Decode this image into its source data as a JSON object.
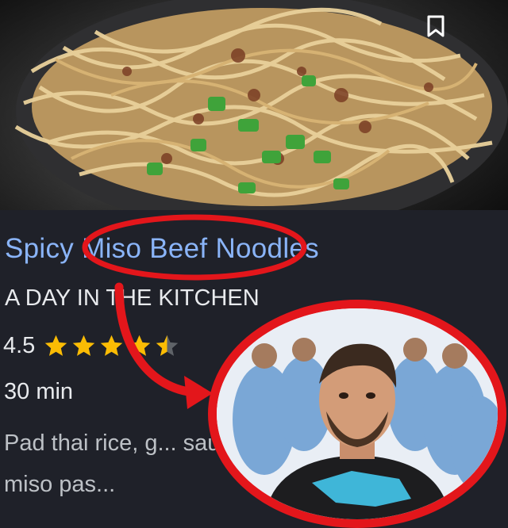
{
  "recipe": {
    "title": "Spicy Miso Beef Noodles",
    "title_visible": "Spicy Miso Beef Noodles",
    "source": "A DAY IN THE KITCHEN",
    "rating": "4.5",
    "stars": 4.5,
    "time": "30 min",
    "ingredients": "Pad thai rice, g... sauce, miso pas..."
  },
  "icons": {
    "bookmark": "bookmark-icon",
    "star": "star-icon"
  },
  "colors": {
    "title": "#8ab4f8",
    "background": "#1f2129",
    "star": "#fbbc04",
    "annotation": "#e3161b"
  }
}
